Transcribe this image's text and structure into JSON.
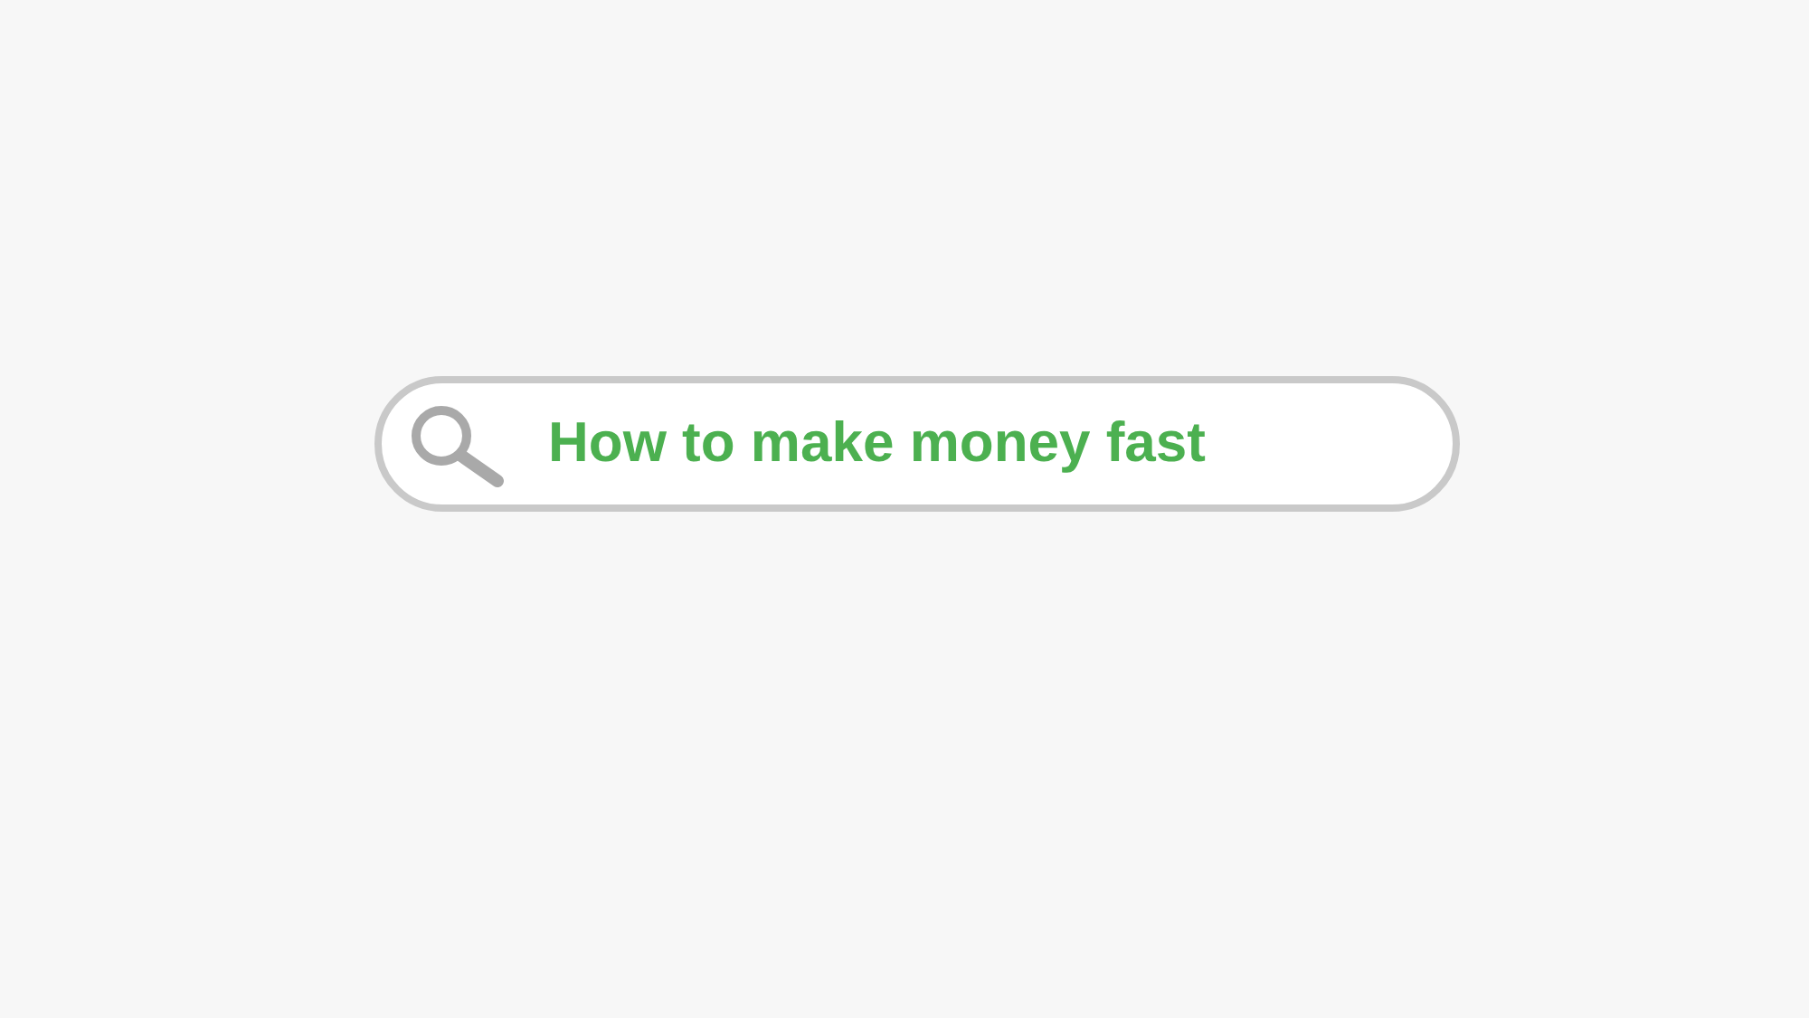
{
  "search": {
    "value": "How to make money fast"
  }
}
